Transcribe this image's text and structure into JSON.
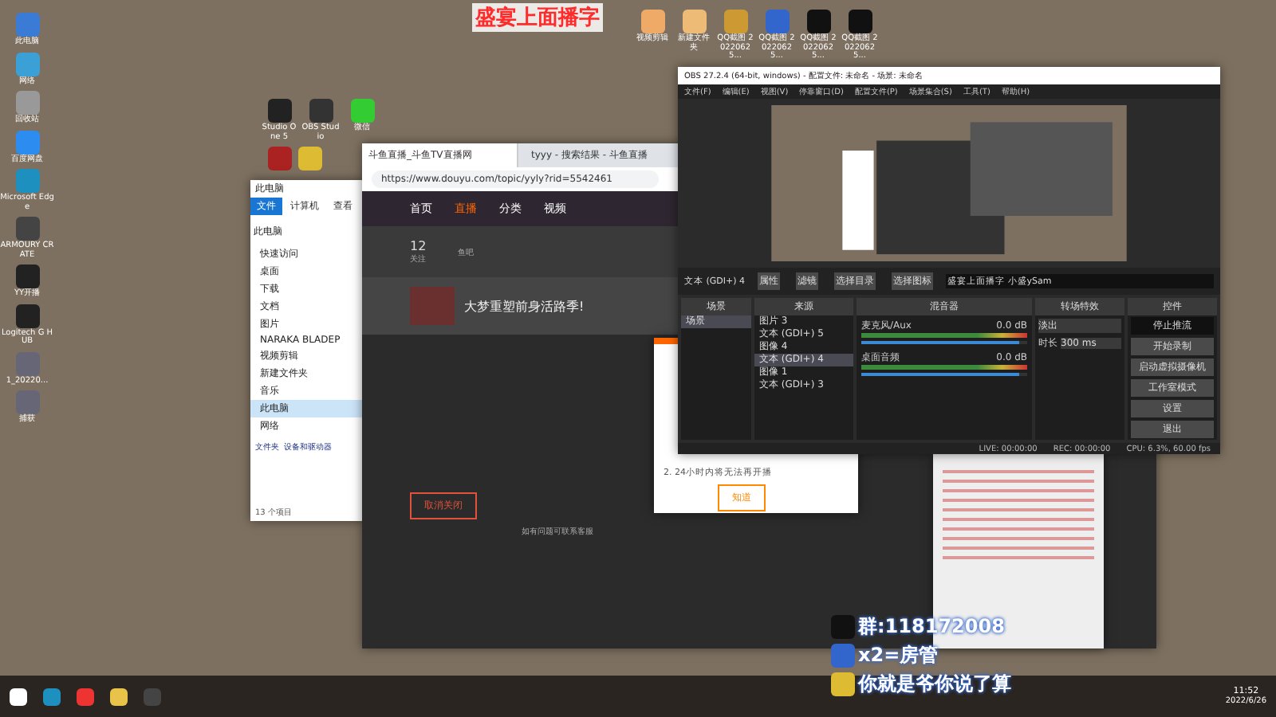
{
  "desktop": {
    "banner": "盛宴上面播字",
    "left_icons": [
      {
        "label": "此电脑"
      },
      {
        "label": "网络"
      },
      {
        "label": "回收站"
      },
      {
        "label": "百度网盘"
      },
      {
        "label": "Microsoft Edge"
      },
      {
        "label": "ARMOURY CRATE"
      },
      {
        "label": "YY开播"
      },
      {
        "label": "Logitech G HUB"
      },
      {
        "label": "1_20220..."
      },
      {
        "label": "捕获"
      }
    ],
    "top_icons": [
      {
        "label": "Studio One 5"
      },
      {
        "label": "OBS Studio"
      },
      {
        "label": "微信"
      }
    ],
    "right_icons": [
      {
        "label": "视频剪辑"
      },
      {
        "label": "新建文件夹"
      },
      {
        "label": "QQ截图 20220625..."
      },
      {
        "label": "QQ截图 20220625..."
      },
      {
        "label": "QQ截图 20220625..."
      },
      {
        "label": "QQ截图 20220625..."
      }
    ]
  },
  "explorer": {
    "title": "此电脑",
    "address": "此电脑",
    "ribbon_tabs": [
      {
        "label": "文件",
        "selected": true
      },
      {
        "label": "计算机",
        "selected": false
      },
      {
        "label": "查看",
        "selected": false
      }
    ],
    "nav": [
      {
        "label": "快速访问",
        "selected": false
      },
      {
        "label": "桌面",
        "selected": false
      },
      {
        "label": "下载",
        "selected": false
      },
      {
        "label": "文档",
        "selected": false
      },
      {
        "label": "图片",
        "selected": false
      },
      {
        "label": "NARAKA BLADEP",
        "selected": false
      },
      {
        "label": "视频剪辑",
        "selected": false
      },
      {
        "label": "新建文件夹",
        "selected": false
      },
      {
        "label": "音乐",
        "selected": false
      },
      {
        "label": "此电脑",
        "selected": true
      },
      {
        "label": "网络",
        "selected": false
      }
    ],
    "sections": [
      "文件夹",
      "设备和驱动器"
    ],
    "status": "13 个项目"
  },
  "browser": {
    "tabs": [
      {
        "label": "斗鱼直播_斗鱼TV直播网",
        "selected": true
      },
      {
        "label": "tyyy - 搜索结果 - 斗鱼直播",
        "selected": false
      }
    ],
    "url": "https://www.douyu.com/topic/yyly?rid=5542461",
    "nav": [
      "首页",
      "直播",
      "分类",
      "视频"
    ],
    "stats": [
      {
        "value": "12",
        "label": "关注"
      },
      {
        "label": "鱼吧"
      }
    ],
    "card_title": "大梦重塑前身活路季!",
    "footer": "如有问题可联系客服",
    "dialog": {
      "text": "2. 24小时内将无法再开播",
      "button": "知道"
    },
    "close_button": "取消关闭"
  },
  "obs": {
    "title": "OBS 27.2.4 (64-bit, windows) - 配置文件: 未命名 - 场景: 未命名",
    "menu": [
      "文件(F)",
      "编辑(E)",
      "视图(V)",
      "停靠窗口(D)",
      "配置文件(P)",
      "场景集合(S)",
      "工具(T)",
      "帮助(H)"
    ],
    "source_bar": {
      "source": "文本 (GDI+) 4",
      "buttons": [
        "属性",
        "滤镜",
        "选择目录",
        "选择图标"
      ],
      "text": "盛宴上面播字 小盛ySam"
    },
    "docks": [
      "场景",
      "来源",
      "混音器",
      "转场特效",
      "控件"
    ],
    "scenes": [
      {
        "label": "场景",
        "selected": true
      }
    ],
    "sources": [
      {
        "label": "图片 3",
        "selected": false
      },
      {
        "label": "文本 (GDI+) 5",
        "selected": false
      },
      {
        "label": "图像 4",
        "selected": false
      },
      {
        "label": "文本 (GDI+) 4",
        "selected": true
      },
      {
        "label": "图像 1",
        "selected": false
      },
      {
        "label": "文本 (GDI+) 3",
        "selected": false
      }
    ],
    "mixer": [
      {
        "name": "麦克风/Aux",
        "reading": "0.0 dB",
        "level": 0.95
      },
      {
        "name": "桌面音频",
        "reading": "0.0 dB",
        "level": 0.95
      }
    ],
    "transition": {
      "value": "淡出",
      "duration_label": "时长",
      "duration": "300 ms"
    },
    "controls": [
      {
        "label": "停止推流",
        "selected": true
      },
      {
        "label": "开始录制",
        "selected": false
      },
      {
        "label": "启动虚拟摄像机",
        "selected": false
      },
      {
        "label": "工作室模式",
        "selected": false
      },
      {
        "label": "设置",
        "selected": false
      },
      {
        "label": "退出",
        "selected": false
      }
    ],
    "status": [
      "LIVE: 00:00:00",
      "REC: 00:00:00",
      "CPU: 6.3%, 60.00 fps"
    ]
  },
  "chat": [
    {
      "text": "群:118172008"
    },
    {
      "text": "x2=房管"
    },
    {
      "text": "你就是爷你说了算"
    }
  ],
  "taskbar": {
    "time": "11:52",
    "date": "2022/6/26"
  }
}
